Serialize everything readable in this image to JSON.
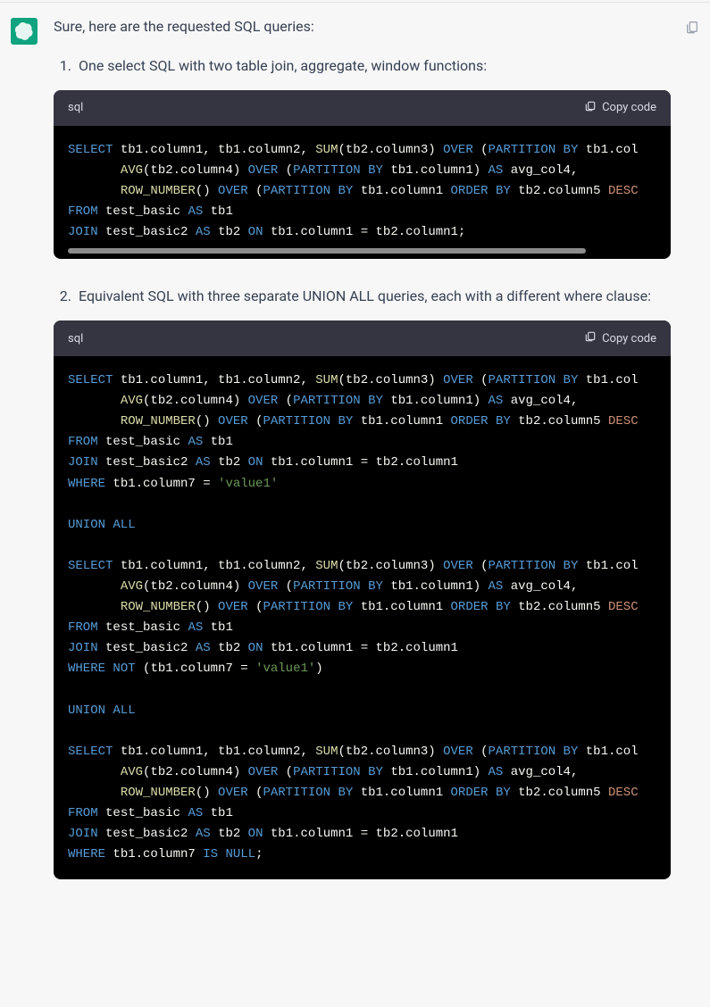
{
  "intro": "Sure, here are the requested SQL queries:",
  "items": [
    {
      "num": "1.",
      "text": "One select SQL with two table join, aggregate, window functions:"
    },
    {
      "num": "2.",
      "text": "Equivalent SQL with three separate UNION ALL queries, each with a different where clause:"
    }
  ],
  "code_lang": "sql",
  "copy_label": "Copy code",
  "code1": {
    "tokens": [
      [
        "kw",
        "SELECT"
      ],
      [
        "w",
        " "
      ],
      [
        "idf",
        "tb1.column1, tb1.column2, "
      ],
      [
        "fn",
        "SUM"
      ],
      [
        "idf",
        "(tb2.column3) "
      ],
      [
        "kw",
        "OVER"
      ],
      [
        "w",
        " "
      ],
      [
        "idf",
        "("
      ],
      [
        "kw",
        "PARTITION BY"
      ],
      [
        "w",
        " "
      ],
      [
        "idf",
        "tb1.col"
      ],
      [
        "nl",
        ""
      ],
      [
        "w",
        "       "
      ],
      [
        "fn",
        "AVG"
      ],
      [
        "idf",
        "(tb2.column4) "
      ],
      [
        "kw",
        "OVER"
      ],
      [
        "w",
        " "
      ],
      [
        "idf",
        "("
      ],
      [
        "kw",
        "PARTITION BY"
      ],
      [
        "w",
        " "
      ],
      [
        "idf",
        "tb1.column1) "
      ],
      [
        "kw",
        "AS"
      ],
      [
        "w",
        " "
      ],
      [
        "idf",
        "avg_col4,"
      ],
      [
        "nl",
        ""
      ],
      [
        "w",
        "       "
      ],
      [
        "fn",
        "ROW_NUMBER"
      ],
      [
        "idf",
        "() "
      ],
      [
        "kw",
        "OVER"
      ],
      [
        "w",
        " "
      ],
      [
        "idf",
        "("
      ],
      [
        "kw",
        "PARTITION BY"
      ],
      [
        "w",
        " "
      ],
      [
        "idf",
        "tb1.column1 "
      ],
      [
        "kw",
        "ORDER BY"
      ],
      [
        "w",
        " "
      ],
      [
        "idf",
        "tb2.column5 "
      ],
      [
        "ord",
        "DESC"
      ],
      [
        "nl",
        ""
      ],
      [
        "kw",
        "FROM"
      ],
      [
        "w",
        " "
      ],
      [
        "idf",
        "test_basic "
      ],
      [
        "kw",
        "AS"
      ],
      [
        "w",
        " "
      ],
      [
        "idf",
        "tb1"
      ],
      [
        "nl",
        ""
      ],
      [
        "kw",
        "JOIN"
      ],
      [
        "w",
        " "
      ],
      [
        "idf",
        "test_basic2 "
      ],
      [
        "kw",
        "AS"
      ],
      [
        "w",
        " "
      ],
      [
        "idf",
        "tb2 "
      ],
      [
        "kw",
        "ON"
      ],
      [
        "w",
        " "
      ],
      [
        "idf",
        "tb1.column1 = tb2.column1;"
      ]
    ]
  },
  "code2": {
    "tokens": [
      [
        "kw",
        "SELECT"
      ],
      [
        "w",
        " "
      ],
      [
        "idf",
        "tb1.column1, tb1.column2, "
      ],
      [
        "fn",
        "SUM"
      ],
      [
        "idf",
        "(tb2.column3) "
      ],
      [
        "kw",
        "OVER"
      ],
      [
        "w",
        " "
      ],
      [
        "idf",
        "("
      ],
      [
        "kw",
        "PARTITION BY"
      ],
      [
        "w",
        " "
      ],
      [
        "idf",
        "tb1.col"
      ],
      [
        "nl",
        ""
      ],
      [
        "w",
        "       "
      ],
      [
        "fn",
        "AVG"
      ],
      [
        "idf",
        "(tb2.column4) "
      ],
      [
        "kw",
        "OVER"
      ],
      [
        "w",
        " "
      ],
      [
        "idf",
        "("
      ],
      [
        "kw",
        "PARTITION BY"
      ],
      [
        "w",
        " "
      ],
      [
        "idf",
        "tb1.column1) "
      ],
      [
        "kw",
        "AS"
      ],
      [
        "w",
        " "
      ],
      [
        "idf",
        "avg_col4,"
      ],
      [
        "nl",
        ""
      ],
      [
        "w",
        "       "
      ],
      [
        "fn",
        "ROW_NUMBER"
      ],
      [
        "idf",
        "() "
      ],
      [
        "kw",
        "OVER"
      ],
      [
        "w",
        " "
      ],
      [
        "idf",
        "("
      ],
      [
        "kw",
        "PARTITION BY"
      ],
      [
        "w",
        " "
      ],
      [
        "idf",
        "tb1.column1 "
      ],
      [
        "kw",
        "ORDER BY"
      ],
      [
        "w",
        " "
      ],
      [
        "idf",
        "tb2.column5 "
      ],
      [
        "ord",
        "DESC"
      ],
      [
        "nl",
        ""
      ],
      [
        "kw",
        "FROM"
      ],
      [
        "w",
        " "
      ],
      [
        "idf",
        "test_basic "
      ],
      [
        "kw",
        "AS"
      ],
      [
        "w",
        " "
      ],
      [
        "idf",
        "tb1"
      ],
      [
        "nl",
        ""
      ],
      [
        "kw",
        "JOIN"
      ],
      [
        "w",
        " "
      ],
      [
        "idf",
        "test_basic2 "
      ],
      [
        "kw",
        "AS"
      ],
      [
        "w",
        " "
      ],
      [
        "idf",
        "tb2 "
      ],
      [
        "kw",
        "ON"
      ],
      [
        "w",
        " "
      ],
      [
        "idf",
        "tb1.column1 = tb2.column1"
      ],
      [
        "nl",
        ""
      ],
      [
        "kw",
        "WHERE"
      ],
      [
        "w",
        " "
      ],
      [
        "idf",
        "tb1.column7 = "
      ],
      [
        "str",
        "'value1'"
      ],
      [
        "nl",
        ""
      ],
      [
        "nl",
        ""
      ],
      [
        "kw",
        "UNION ALL"
      ],
      [
        "nl",
        ""
      ],
      [
        "nl",
        ""
      ],
      [
        "kw",
        "SELECT"
      ],
      [
        "w",
        " "
      ],
      [
        "idf",
        "tb1.column1, tb1.column2, "
      ],
      [
        "fn",
        "SUM"
      ],
      [
        "idf",
        "(tb2.column3) "
      ],
      [
        "kw",
        "OVER"
      ],
      [
        "w",
        " "
      ],
      [
        "idf",
        "("
      ],
      [
        "kw",
        "PARTITION BY"
      ],
      [
        "w",
        " "
      ],
      [
        "idf",
        "tb1.col"
      ],
      [
        "nl",
        ""
      ],
      [
        "w",
        "       "
      ],
      [
        "fn",
        "AVG"
      ],
      [
        "idf",
        "(tb2.column4) "
      ],
      [
        "kw",
        "OVER"
      ],
      [
        "w",
        " "
      ],
      [
        "idf",
        "("
      ],
      [
        "kw",
        "PARTITION BY"
      ],
      [
        "w",
        " "
      ],
      [
        "idf",
        "tb1.column1) "
      ],
      [
        "kw",
        "AS"
      ],
      [
        "w",
        " "
      ],
      [
        "idf",
        "avg_col4,"
      ],
      [
        "nl",
        ""
      ],
      [
        "w",
        "       "
      ],
      [
        "fn",
        "ROW_NUMBER"
      ],
      [
        "idf",
        "() "
      ],
      [
        "kw",
        "OVER"
      ],
      [
        "w",
        " "
      ],
      [
        "idf",
        "("
      ],
      [
        "kw",
        "PARTITION BY"
      ],
      [
        "w",
        " "
      ],
      [
        "idf",
        "tb1.column1 "
      ],
      [
        "kw",
        "ORDER BY"
      ],
      [
        "w",
        " "
      ],
      [
        "idf",
        "tb2.column5 "
      ],
      [
        "ord",
        "DESC"
      ],
      [
        "nl",
        ""
      ],
      [
        "kw",
        "FROM"
      ],
      [
        "w",
        " "
      ],
      [
        "idf",
        "test_basic "
      ],
      [
        "kw",
        "AS"
      ],
      [
        "w",
        " "
      ],
      [
        "idf",
        "tb1"
      ],
      [
        "nl",
        ""
      ],
      [
        "kw",
        "JOIN"
      ],
      [
        "w",
        " "
      ],
      [
        "idf",
        "test_basic2 "
      ],
      [
        "kw",
        "AS"
      ],
      [
        "w",
        " "
      ],
      [
        "idf",
        "tb2 "
      ],
      [
        "kw",
        "ON"
      ],
      [
        "w",
        " "
      ],
      [
        "idf",
        "tb1.column1 = tb2.column1"
      ],
      [
        "nl",
        ""
      ],
      [
        "kw",
        "WHERE"
      ],
      [
        "w",
        " "
      ],
      [
        "kw",
        "NOT"
      ],
      [
        "w",
        " "
      ],
      [
        "idf",
        "(tb1.column7 = "
      ],
      [
        "str",
        "'value1'"
      ],
      [
        "idf",
        ")"
      ],
      [
        "nl",
        ""
      ],
      [
        "nl",
        ""
      ],
      [
        "kw",
        "UNION ALL"
      ],
      [
        "nl",
        ""
      ],
      [
        "nl",
        ""
      ],
      [
        "kw",
        "SELECT"
      ],
      [
        "w",
        " "
      ],
      [
        "idf",
        "tb1.column1, tb1.column2, "
      ],
      [
        "fn",
        "SUM"
      ],
      [
        "idf",
        "(tb2.column3) "
      ],
      [
        "kw",
        "OVER"
      ],
      [
        "w",
        " "
      ],
      [
        "idf",
        "("
      ],
      [
        "kw",
        "PARTITION BY"
      ],
      [
        "w",
        " "
      ],
      [
        "idf",
        "tb1.col"
      ],
      [
        "nl",
        ""
      ],
      [
        "w",
        "       "
      ],
      [
        "fn",
        "AVG"
      ],
      [
        "idf",
        "(tb2.column4) "
      ],
      [
        "kw",
        "OVER"
      ],
      [
        "w",
        " "
      ],
      [
        "idf",
        "("
      ],
      [
        "kw",
        "PARTITION BY"
      ],
      [
        "w",
        " "
      ],
      [
        "idf",
        "tb1.column1) "
      ],
      [
        "kw",
        "AS"
      ],
      [
        "w",
        " "
      ],
      [
        "idf",
        "avg_col4,"
      ],
      [
        "nl",
        ""
      ],
      [
        "w",
        "       "
      ],
      [
        "fn",
        "ROW_NUMBER"
      ],
      [
        "idf",
        "() "
      ],
      [
        "kw",
        "OVER"
      ],
      [
        "w",
        " "
      ],
      [
        "idf",
        "("
      ],
      [
        "kw",
        "PARTITION BY"
      ],
      [
        "w",
        " "
      ],
      [
        "idf",
        "tb1.column1 "
      ],
      [
        "kw",
        "ORDER BY"
      ],
      [
        "w",
        " "
      ],
      [
        "idf",
        "tb2.column5 "
      ],
      [
        "ord",
        "DESC"
      ],
      [
        "nl",
        ""
      ],
      [
        "kw",
        "FROM"
      ],
      [
        "w",
        " "
      ],
      [
        "idf",
        "test_basic "
      ],
      [
        "kw",
        "AS"
      ],
      [
        "w",
        " "
      ],
      [
        "idf",
        "tb1"
      ],
      [
        "nl",
        ""
      ],
      [
        "kw",
        "JOIN"
      ],
      [
        "w",
        " "
      ],
      [
        "idf",
        "test_basic2 "
      ],
      [
        "kw",
        "AS"
      ],
      [
        "w",
        " "
      ],
      [
        "idf",
        "tb2 "
      ],
      [
        "kw",
        "ON"
      ],
      [
        "w",
        " "
      ],
      [
        "idf",
        "tb1.column1 = tb2.column1"
      ],
      [
        "nl",
        ""
      ],
      [
        "kw",
        "WHERE"
      ],
      [
        "w",
        " "
      ],
      [
        "idf",
        "tb1.column7 "
      ],
      [
        "kw",
        "IS NULL"
      ],
      [
        "idf",
        ";"
      ]
    ]
  }
}
